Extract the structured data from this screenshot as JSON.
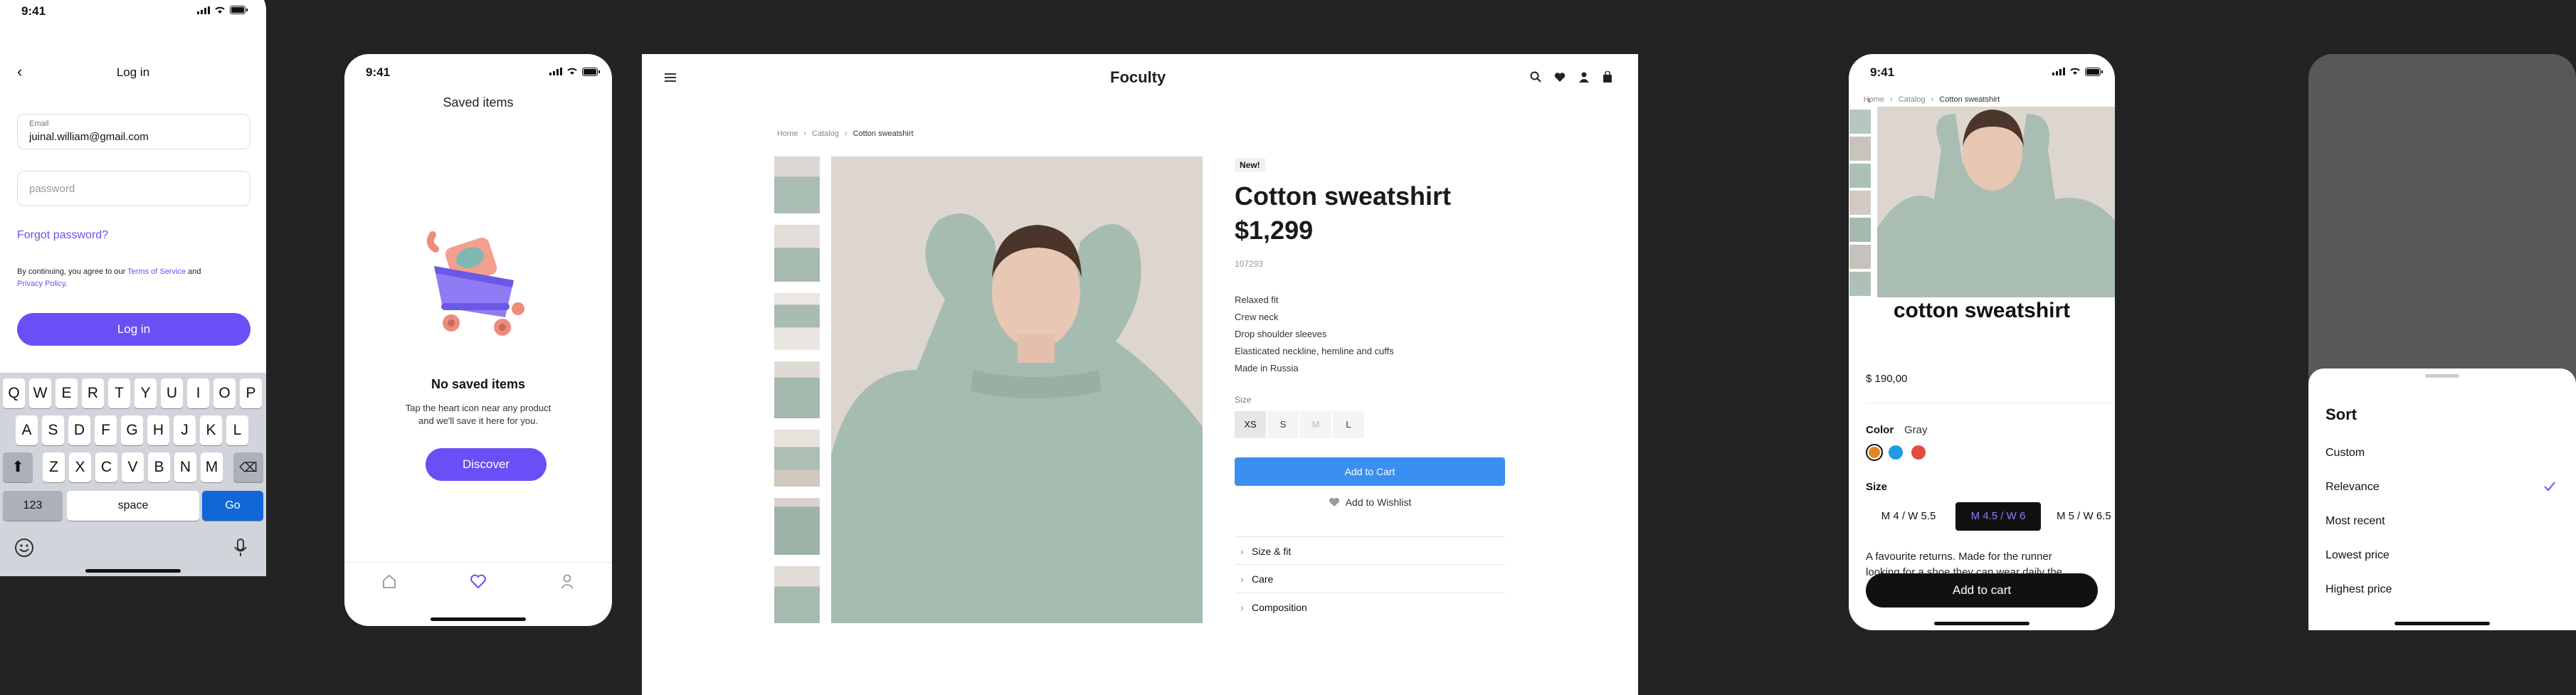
{
  "login_screen": {
    "time": "9:41",
    "title": "Log in",
    "email_label": "Email",
    "email_value": "juinal.william@gmail.com",
    "password_placeholder": "password",
    "forgot_password": "Forgot password?",
    "terms_prefix": "By continuing, you agree to our ",
    "terms_link": "Terms of Service",
    "terms_and": " and",
    "privacy_link": "Privacy Policy",
    "terms_end": ".",
    "login_button": "Log in",
    "keyboard": {
      "row1": [
        "Q",
        "W",
        "E",
        "R",
        "T",
        "Y",
        "U",
        "I",
        "O",
        "P"
      ],
      "row2": [
        "A",
        "S",
        "D",
        "F",
        "G",
        "H",
        "J",
        "K",
        "L"
      ],
      "row3": [
        "Z",
        "X",
        "C",
        "V",
        "B",
        "N",
        "M"
      ],
      "numbers_key": "123",
      "space_key": "space",
      "go_key": "Go"
    }
  },
  "saved_screen": {
    "time": "9:41",
    "title": "Saved items",
    "empty_title": "No saved items",
    "empty_text_line1": "Tap the heart icon near any product",
    "empty_text_line2": "and we'll save it here for you.",
    "discover_button": "Discover"
  },
  "desktop": {
    "brand": "Foculty",
    "breadcrumb": [
      "Home",
      "Catalog",
      "Cotton sweatshirt"
    ],
    "badge": "New!",
    "product_title": "Cotton sweatshirt",
    "price": "$1,299",
    "sku": "107293",
    "features": [
      "Relaxed fit",
      "Crew neck",
      "Drop shoulder sleeves",
      "Elasticated neckline, hemline and cuffs",
      "Made in Russia"
    ],
    "size_label": "Size",
    "sizes": [
      "XS",
      "S",
      "M",
      "L"
    ],
    "selected_size": "XS",
    "add_to_cart": "Add to Cart",
    "add_to_wishlist": "Add to Wishlist",
    "accordion": [
      "Size & fit",
      "Care",
      "Composition"
    ],
    "colors": {
      "accent_blue": "#3b8ff0"
    }
  },
  "mobile_product": {
    "time": "9:41",
    "breadcrumb": [
      "Home",
      "Catalog",
      "Cotton sweatshirt"
    ],
    "product_title": "cotton sweatshirt",
    "price": "$ 190,00",
    "color_label": "Color",
    "color_value": "Gray",
    "swatches": [
      "#e3861f",
      "#1f9ce3",
      "#e34b3c"
    ],
    "size_label": "Size",
    "sizes": [
      "M 4 / W 5.5",
      "M 4.5 / W 6",
      "M 5 / W 6.5"
    ],
    "selected_size": "M 4.5 / W 6",
    "description_line1": "A favourite returns. Made for the runner",
    "description_line2": "looking for a shoe they can wear daily the",
    "add_to_cart": "Add to cart"
  },
  "sort_sheet": {
    "title": "Sort",
    "options": [
      "Custom",
      "Relevance",
      "Most recent",
      "Lowest price",
      "Highest price"
    ],
    "selected": "Relevance"
  }
}
